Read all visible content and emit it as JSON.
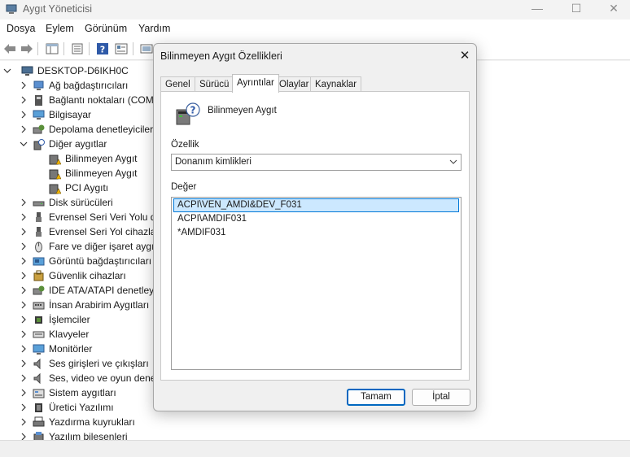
{
  "window": {
    "title": "Aygıt Yöneticisi",
    "min_glyph": "—",
    "max_glyph": "☐",
    "close_glyph": "✕"
  },
  "menu": [
    "Dosya",
    "Eylem",
    "Görünüm",
    "Yardım"
  ],
  "tree": {
    "root": "DESKTOP-D6IKH0C",
    "items": [
      {
        "label": "Ağ bağdaştırıcıları",
        "icon": "network-adapter-icon"
      },
      {
        "label": "Bağlantı noktaları (COM",
        "icon": "port-icon"
      },
      {
        "label": "Bilgisayar",
        "icon": "computer-icon"
      },
      {
        "label": "Depolama denetleyicileri",
        "icon": "storage-controller-icon"
      },
      {
        "label": "Diğer aygıtlar",
        "icon": "other-devices-icon",
        "expanded": true
      },
      {
        "label": "Bilinmeyen Aygıt",
        "icon": "warning-device-icon",
        "child": true
      },
      {
        "label": "Bilinmeyen Aygıt",
        "icon": "warning-device-icon",
        "child": true
      },
      {
        "label": "PCI Aygıtı",
        "icon": "warning-device-icon",
        "child": true
      },
      {
        "label": "Disk sürücüleri",
        "icon": "disk-drive-icon"
      },
      {
        "label": "Evrensel Seri Veri Yolu de",
        "icon": "usb-icon"
      },
      {
        "label": "Evrensel Seri Yol cihazları",
        "icon": "usb-icon"
      },
      {
        "label": "Fare ve diğer işaret aygıt",
        "icon": "mouse-icon"
      },
      {
        "label": "Görüntü bağdaştırıcıları",
        "icon": "display-adapter-icon"
      },
      {
        "label": "Güvenlik cihazları",
        "icon": "security-device-icon"
      },
      {
        "label": "IDE ATA/ATAPI denetley",
        "icon": "ide-controller-icon"
      },
      {
        "label": "İnsan Arabirim Aygıtları",
        "icon": "hid-icon"
      },
      {
        "label": "İşlemciler",
        "icon": "processor-icon"
      },
      {
        "label": "Klavyeler",
        "icon": "keyboard-icon"
      },
      {
        "label": "Monitörler",
        "icon": "monitor-icon"
      },
      {
        "label": "Ses girişleri ve çıkışları",
        "icon": "audio-icon"
      },
      {
        "label": "Ses, video ve oyun dene",
        "icon": "audio-icon"
      },
      {
        "label": "Sistem aygıtları",
        "icon": "system-device-icon"
      },
      {
        "label": "Üretici Yazılımı",
        "icon": "firmware-icon"
      },
      {
        "label": "Yazdırma kuyrukları",
        "icon": "printer-icon"
      },
      {
        "label": "Yazılım bileşenleri",
        "icon": "software-component-icon"
      }
    ]
  },
  "dialog": {
    "title": "Bilinmeyen Aygıt Özellikleri",
    "close_glyph": "✕",
    "tabs": [
      "Genel",
      "Sürücü",
      "Ayrıntılar",
      "Olaylar",
      "Kaynaklar"
    ],
    "active_tab": "Ayrıntılar",
    "device_name": "Bilinmeyen Aygıt",
    "property_label": "Özellik",
    "property_value": "Donanım kimlikleri",
    "value_label": "Değer",
    "values": [
      "ACPI\\VEN_AMDI&DEV_F031",
      "ACPI\\AMDIF031",
      "*AMDIF031"
    ],
    "selected_value_index": 0,
    "ok_label": "Tamam",
    "cancel_label": "İptal"
  },
  "colors": {
    "accent": "#0067c0",
    "selection": "#cce8ff",
    "warning": "#f0b400"
  }
}
